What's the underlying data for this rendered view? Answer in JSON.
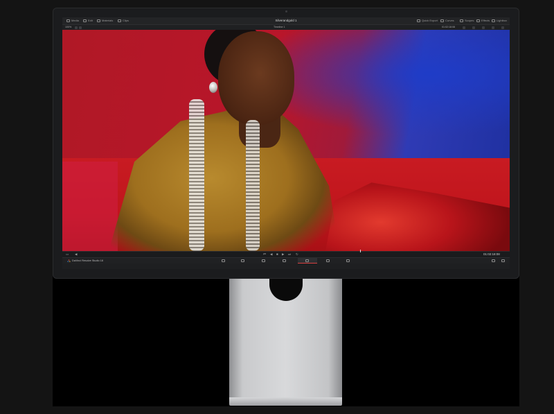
{
  "app": {
    "name": "DaVinci Resolve Studio 18",
    "project_title": "Silverandgold 1"
  },
  "topbar": {
    "left_items": [
      {
        "label": "Media",
        "icon": "media-icon"
      },
      {
        "label": "Edit",
        "icon": "edit-icon"
      },
      {
        "label": "Materials",
        "icon": "materials-icon"
      },
      {
        "label": "Clips",
        "icon": "clips-icon"
      }
    ],
    "right_items": [
      {
        "label": "Quick Export",
        "icon": "export-icon"
      },
      {
        "label": "Curves",
        "icon": "curves-icon"
      },
      {
        "label": "Scopes",
        "icon": "scopes-icon"
      },
      {
        "label": "Effects",
        "icon": "effects-icon"
      },
      {
        "label": "Lightbox",
        "icon": "lightbox-icon"
      }
    ]
  },
  "subbar": {
    "zoom": "100%",
    "timeline_name": "Timeline 1",
    "timecode": "01:02:18:08"
  },
  "transport": {
    "timecode": "01:02:18:08",
    "controls": [
      "skip-back-icon",
      "play-reverse-icon",
      "stop-icon",
      "play-icon",
      "skip-forward-icon",
      "loop-icon"
    ]
  },
  "pagebar": {
    "app_label": "DaVinci Resolve Studio 18",
    "pages": [
      "media-page-icon",
      "cut-page-icon",
      "edit-page-icon",
      "fusion-page-icon",
      "color-page-icon",
      "fairlight-page-icon",
      "deliver-page-icon"
    ],
    "active_page": "color-page-icon",
    "right_icons": [
      "home-icon",
      "settings-icon"
    ]
  },
  "colors": {
    "accent": "#d94040",
    "panel": "#1e1f21"
  }
}
